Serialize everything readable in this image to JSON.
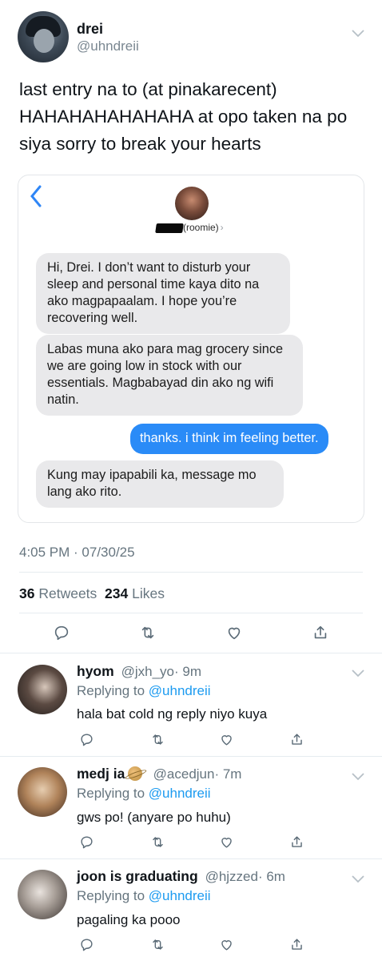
{
  "tweet": {
    "author_name": "drei",
    "author_handle": "@uhndreii",
    "text": "last entry na to (at pinakarecent) HAHAHAHAHAHAHA at opo taken na po siya sorry to break your hearts",
    "timestamp": "4:05 PM · 07/30/25",
    "retweets": "36",
    "retweets_label": "Retweets",
    "likes": "234",
    "likes_label": "Likes"
  },
  "chat": {
    "contact_suffix": "(roomie)",
    "messages": [
      {
        "from": "them",
        "text": "Hi, Drei. I don’t want to disturb your sleep and personal time kaya dito na ako magpapaalam. I hope you’re recovering well."
      },
      {
        "from": "them",
        "text": "Labas muna ako para mag grocery since we are going low in stock with our essentials. Magbabayad din ako ng wifi natin."
      },
      {
        "from": "me",
        "text": "thanks. i think im feeling better."
      },
      {
        "from": "them",
        "text": "Kung may ipapabili ka, message mo lang ako rito."
      }
    ]
  },
  "replies": [
    {
      "name": "hyom",
      "handle": "@jxh_yo",
      "time": "· 9m",
      "replying_prefix": "Replying to",
      "replying_to": "@uhndreii",
      "text": "hala bat cold ng reply niyo kuya"
    },
    {
      "name": "medj ia",
      "handle": "@acedjun",
      "time": "· 7m",
      "replying_prefix": "Replying to",
      "replying_to": "@uhndreii",
      "text": "gws po! (anyare po huhu)"
    },
    {
      "name": "joon is graduating",
      "handle": "@hjzzed",
      "time": "· 6m",
      "replying_prefix": "Replying to",
      "replying_to": "@uhndreii",
      "text": "pagaling ka pooo"
    }
  ],
  "icons": {
    "more": "chevron-down-icon",
    "reply": "comment-icon",
    "retweet": "retweet-icon",
    "like": "heart-icon",
    "share": "share-icon",
    "back": "chevron-left-icon",
    "reaction_emoji": "saturn-emoji-icon"
  },
  "colors": {
    "link": "#1d9bf0",
    "imessage_blue": "#2a8bf7",
    "imessage_gray": "#e9e9eb",
    "secondary_text": "#66757f"
  }
}
